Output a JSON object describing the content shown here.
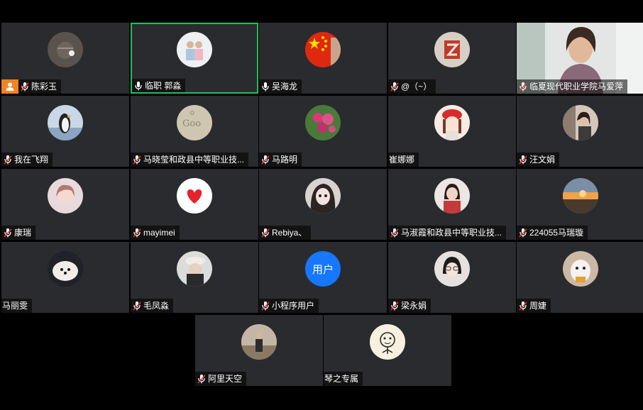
{
  "participants": [
    {
      "name": "陈彩玉",
      "mic": "muted",
      "avatar": "dark-grey-icon-avatar",
      "host": true
    },
    {
      "name": "临职 郭淼",
      "mic": "on",
      "avatar": "kids-photo-avatar",
      "active": true
    },
    {
      "name": "吴海龙",
      "mic": "on",
      "avatar": "chinese-flag-avatar"
    },
    {
      "name": "@（~）",
      "mic": "muted",
      "avatar": "stamp-graphic-avatar"
    },
    {
      "name": "临夏现代职业学院马爱萍",
      "mic": "muted",
      "video": "camera-feed-woman"
    },
    {
      "name": "我在飞翔",
      "mic": "muted",
      "avatar": "penguin-avatar"
    },
    {
      "name": "马晓莹和政县中等职业技...",
      "mic": "muted",
      "avatar": "sand-writing-avatar"
    },
    {
      "name": "马路明",
      "mic": "muted",
      "avatar": "pink-flowers-avatar"
    },
    {
      "name": "崔娜娜",
      "mic": "none",
      "avatar": "cartoon-girl-avatar"
    },
    {
      "name": "汪文娟",
      "mic": "muted",
      "avatar": "woman-in-car-avatar"
    },
    {
      "name": "康瑞",
      "mic": "muted",
      "avatar": "pastel-girl-avatar"
    },
    {
      "name": "mayimei",
      "mic": "muted",
      "avatar": "red-heart-avatar"
    },
    {
      "name": "Rebiya、",
      "mic": "muted",
      "avatar": "anime-girl-avatar"
    },
    {
      "name": "马淑霞和政县中等职业技...",
      "mic": "muted",
      "avatar": "woman-portrait-avatar"
    },
    {
      "name": "224055马瑞璇",
      "mic": "muted",
      "avatar": "sunset-avatar"
    },
    {
      "name": "马丽雯",
      "mic": "none",
      "avatar": "fluffy-dog-avatar"
    },
    {
      "name": "毛凤淼",
      "mic": "muted",
      "avatar": "hat-girl-avatar"
    },
    {
      "name": "小程序用户",
      "mic": "muted",
      "avatar_text": "用户"
    },
    {
      "name": "梁永娟",
      "mic": "muted",
      "avatar": "girl-face-avatar"
    },
    {
      "name": "周婕",
      "mic": "muted",
      "avatar": "white-dog-avatar"
    },
    {
      "name": "阿里天空",
      "mic": "muted",
      "avatar": "person-outdoors-avatar"
    },
    {
      "name": "琴之专属",
      "mic": "none",
      "avatar": "cartoon-doodle-avatar"
    }
  ],
  "colors": {
    "tile_bg": "#2a2b2e",
    "active_border": "#20c05c",
    "host_badge": "#f58220",
    "muted_red": "#e53935",
    "user_avatar_blue": "#1677ff"
  }
}
